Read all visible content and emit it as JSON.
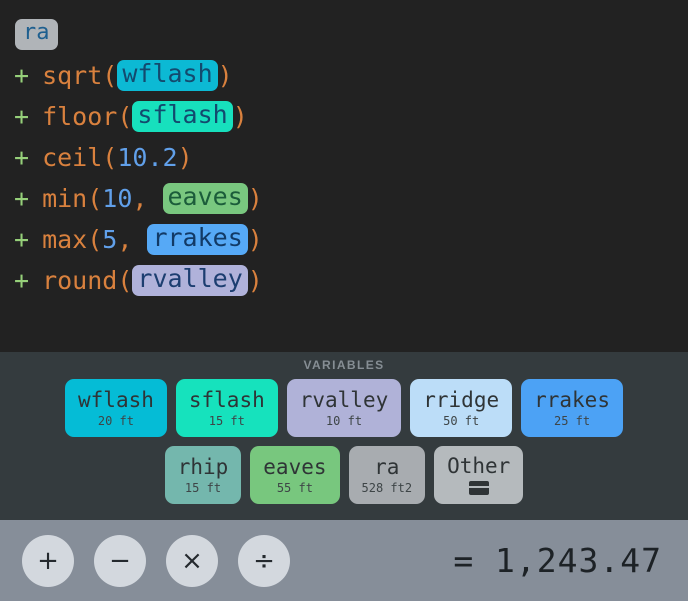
{
  "formula": {
    "head_token": "ra",
    "lines": [
      {
        "operator": "+",
        "func": "sqrt",
        "open": "(",
        "args": [
          {
            "type": "token",
            "text": "wflash",
            "style": "wflash"
          }
        ],
        "close": ")"
      },
      {
        "operator": "+",
        "func": "floor",
        "open": "(",
        "args": [
          {
            "type": "token",
            "text": "sflash",
            "style": "sflash"
          }
        ],
        "close": ")"
      },
      {
        "operator": "+",
        "func": "ceil",
        "open": "(",
        "args": [
          {
            "type": "number",
            "text": "10.2"
          }
        ],
        "close": ")"
      },
      {
        "operator": "+",
        "func": "min",
        "open": "(",
        "args": [
          {
            "type": "number",
            "text": "10"
          },
          {
            "type": "token",
            "text": "eaves",
            "style": "eaves"
          }
        ],
        "close": ")"
      },
      {
        "operator": "+",
        "func": "max",
        "open": "(",
        "args": [
          {
            "type": "number",
            "text": "5"
          },
          {
            "type": "token",
            "text": "rrakes",
            "style": "rrakes"
          }
        ],
        "close": ")"
      },
      {
        "operator": "+",
        "func": "round",
        "open": "(",
        "args": [
          {
            "type": "token",
            "text": "rvalley",
            "style": "rvalley"
          }
        ],
        "close": ")"
      }
    ]
  },
  "variables": {
    "section_label": "VARIABLES",
    "rows": [
      [
        {
          "name": "wflash",
          "value": "20 ft",
          "color": "#05bcd6"
        },
        {
          "name": "sflash",
          "value": "15 ft",
          "color": "#16e2bd"
        },
        {
          "name": "rvalley",
          "value": "10 ft",
          "color": "#b0b2d8"
        },
        {
          "name": "rridge",
          "value": "50 ft",
          "color": "#bcddf8"
        },
        {
          "name": "rrakes",
          "value": "25 ft",
          "color": "#4ca2f5"
        }
      ],
      [
        {
          "name": "rhip",
          "value": "15 ft",
          "color": "#74b7ad"
        },
        {
          "name": "eaves",
          "value": "55 ft",
          "color": "#78c77e"
        },
        {
          "name": "ra",
          "value": "528 ft2",
          "color": "#a8acb0"
        },
        {
          "name": "Other",
          "value": "",
          "color": "#b5babd",
          "icon": "keyboard-icon"
        }
      ]
    ]
  },
  "operators": [
    {
      "label": "+",
      "name": "add"
    },
    {
      "label": "−",
      "name": "subtract"
    },
    {
      "label": "×",
      "name": "multiply"
    },
    {
      "label": "÷",
      "name": "divide"
    }
  ],
  "result": {
    "text": "=  1,243.47"
  },
  "colors": {
    "editor_background": "#222222",
    "variables_background": "#343b3e",
    "operator_bar_background": "#868e99",
    "function_name": "#d9813e",
    "number": "#61a0ea",
    "plus_operator": "#96d07a"
  }
}
